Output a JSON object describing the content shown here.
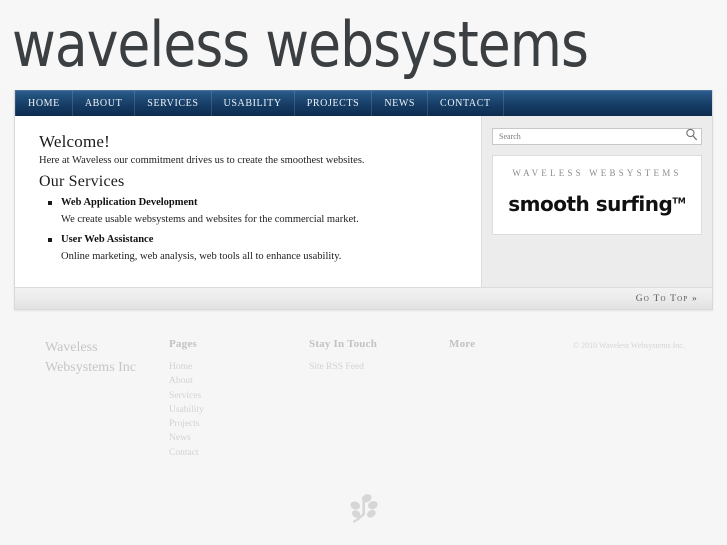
{
  "site": {
    "logo": "waveless websystems"
  },
  "nav": {
    "items": [
      {
        "label": "Home",
        "name": "nav-item-home"
      },
      {
        "label": "About",
        "name": "nav-item-about"
      },
      {
        "label": "Services",
        "name": "nav-item-services"
      },
      {
        "label": "Usability",
        "name": "nav-item-usability"
      },
      {
        "label": "Projects",
        "name": "nav-item-projects"
      },
      {
        "label": "News",
        "name": "nav-item-news"
      },
      {
        "label": "Contact",
        "name": "nav-item-contact"
      }
    ]
  },
  "content": {
    "welcome_heading": "Welcome!",
    "intro": "Here at Waveless our commitment drives us to create the smoothest websites.",
    "services_heading": "Our Services",
    "services": [
      {
        "title": "Web Application Development",
        "description": "We create usable websystems and websites for the commercial market."
      },
      {
        "title": "User Web Assistance",
        "description": "Online marketing, web analysis, web tools all to enhance usability."
      }
    ]
  },
  "sidebar": {
    "search": {
      "placeholder": "Search",
      "value": "",
      "icon": "search-icon"
    },
    "promo": {
      "kicker": "WAVELESS WEBSYSTEMS",
      "headline": "smooth surfing",
      "trademark": "TM"
    }
  },
  "gototop": {
    "label": "Go To Top »"
  },
  "footer": {
    "brand": "Waveless Websystems Inc",
    "columns": [
      {
        "heading": "Pages",
        "links": [
          "Home",
          "About",
          "Services",
          "Usability",
          "Projects",
          "News",
          "Contact"
        ]
      },
      {
        "heading": "Stay In Touch",
        "links": [
          "Site RSS Feed"
        ]
      },
      {
        "heading": "More",
        "links": []
      }
    ],
    "copyright": "© 2010 Waveless Websystems Inc.",
    "leaf_icon": "leaf-icon"
  },
  "colors": {
    "nav_top": "#2f5d93",
    "nav_bottom": "#0e2c4e",
    "logo": "#3b3f42",
    "page_bg": "#f6f6f6",
    "sidebar_bg": "#ececec",
    "footer_text": "#d2d2d2"
  }
}
